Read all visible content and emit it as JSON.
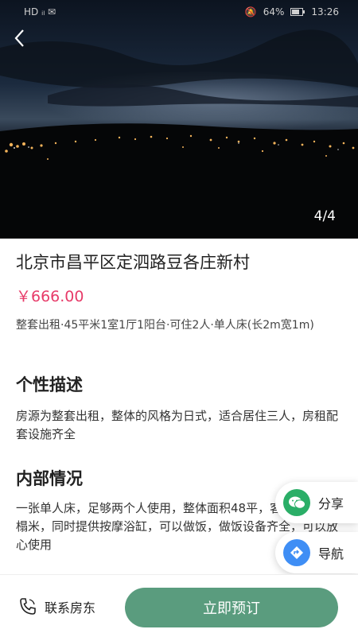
{
  "status_bar": {
    "left": "HD ᵢₗ ✉",
    "battery": "64%",
    "time": "13:26"
  },
  "gallery": {
    "pager": "4/4"
  },
  "listing": {
    "title": "北京市昌平区定泗路豆各庄新村",
    "price": "￥666.00",
    "summary": "整套出租·45平米1室1厅1阳台·可住2人·单人床(长2m宽1m)"
  },
  "sections": [
    {
      "heading": "个性描述",
      "body": "房源为整套出租，整体的风格为日式，适合居住三人，房租配套设施齐全"
    },
    {
      "heading": "内部情况",
      "body": "一张单人床，足够两个人使用，整体面积48平，客厅有一张榻榻米，同时提供按摩浴缸，可以做饭，做饭设备齐全，可以放心使用"
    }
  ],
  "floating": {
    "share_label": "分享",
    "nav_label": "导航"
  },
  "bottom_bar": {
    "contact_label": "联系房东",
    "book_label": "立即预订"
  },
  "colors": {
    "price": "#e73b69",
    "primary": "#5a9c7e",
    "wechat": "#2aae67",
    "nav": "#3f8ef5"
  }
}
